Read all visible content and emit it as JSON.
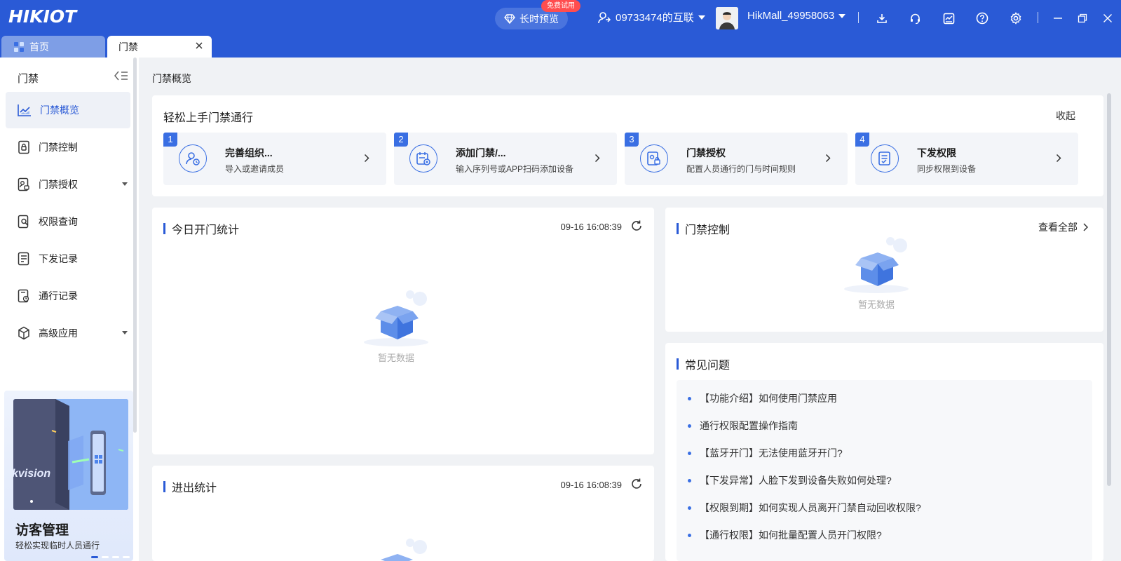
{
  "app": {
    "logo": "HIKIOT",
    "preview_label": "长时预览",
    "trial_badge": "免费试用",
    "org_name": "09733474的互联",
    "username": "HikMall_49958063"
  },
  "tabs": [
    {
      "label": "首页"
    },
    {
      "label": "门禁"
    }
  ],
  "sidebar": {
    "title": "门禁",
    "items": [
      {
        "label": "门禁概览",
        "icon": "chart-icon"
      },
      {
        "label": "门禁控制",
        "icon": "door-lock-icon"
      },
      {
        "label": "门禁授权",
        "icon": "auth-icon"
      },
      {
        "label": "权限查询",
        "icon": "search-doc-icon"
      },
      {
        "label": "下发记录",
        "icon": "list-icon"
      },
      {
        "label": "通行记录",
        "icon": "pass-icon"
      },
      {
        "label": "高级应用",
        "icon": "cube-icon"
      }
    ],
    "promo": {
      "title": "访客管理",
      "subtitle": "轻松实现临时人员通行",
      "img_text": "kvision"
    }
  },
  "breadcrumb": "门禁概览",
  "guide": {
    "title": "轻松上手门禁通行",
    "collapse_label": "收起",
    "steps": [
      {
        "num": "1",
        "title": "完善组织...",
        "desc": "导入或邀请成员"
      },
      {
        "num": "2",
        "title": "添加门禁/...",
        "desc": "输入序列号或APP扫码添加设备"
      },
      {
        "num": "3",
        "title": "门禁授权",
        "desc": "配置人员通行的门与时间规则"
      },
      {
        "num": "4",
        "title": "下发权限",
        "desc": "同步权限到设备"
      }
    ]
  },
  "today_stats": {
    "title": "今日开门统计",
    "time": "09-16 16:08:39",
    "empty": "暂无数据"
  },
  "door_control": {
    "title": "门禁控制",
    "view_all": "查看全部",
    "empty": "暂无数据"
  },
  "inout_stats": {
    "title": "进出统计",
    "time": "09-16 16:08:39"
  },
  "faq": {
    "title": "常见问题",
    "items": [
      "【功能介绍】如何使用门禁应用",
      "通行权限配置操作指南",
      "【蓝牙开门】无法使用蓝牙开门?",
      "【下发异常】人脸下发到设备失败如何处理?",
      "【权限到期】如何实现人员离开门禁自动回收权限?",
      "【通行权限】如何批量配置人员开门权限?"
    ]
  },
  "colors": {
    "brand": "#2a5ad6",
    "accent": "#3a6fe3",
    "badge": "#ff4d4f"
  }
}
